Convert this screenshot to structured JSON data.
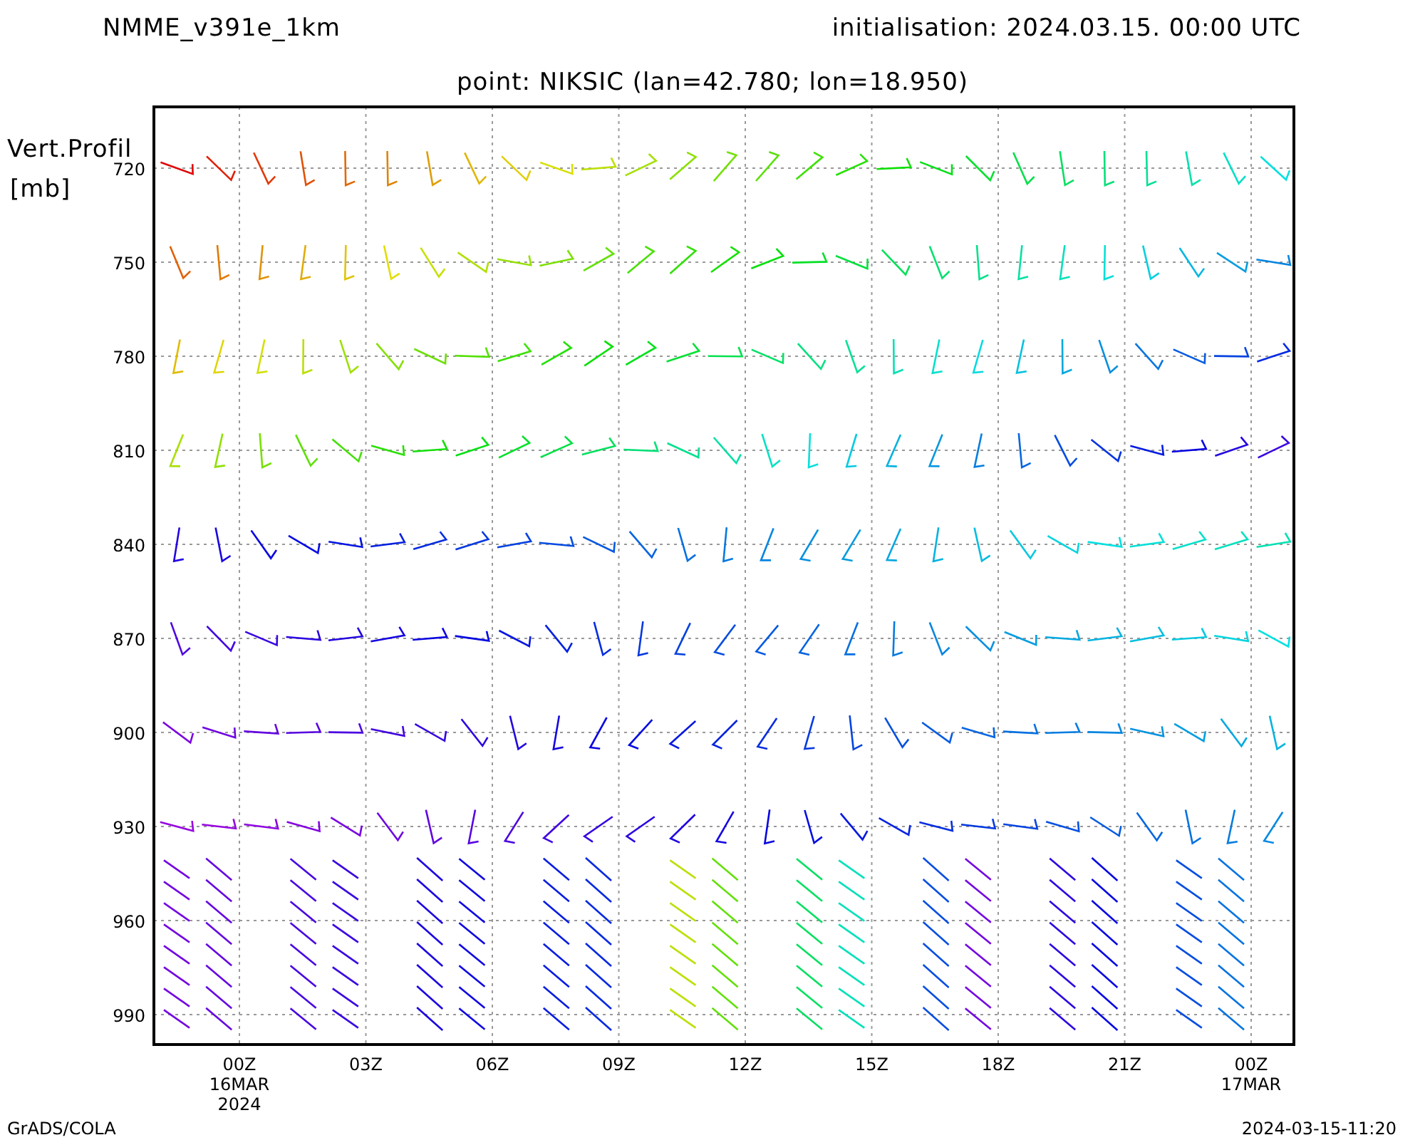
{
  "header": {
    "model": "NMME_v391e_1km",
    "initialisation": "initialisation: 2024.03.15. 00:00 UTC",
    "point": "point: NIKSIC (lan=42.780; lon=18.950)"
  },
  "y_axis": {
    "title": "Vert.Profil",
    "unit": "[mb]",
    "labels": [
      "720",
      "750",
      "780",
      "810",
      "840",
      "870",
      "900",
      "930",
      "960",
      "990"
    ]
  },
  "x_axis": {
    "labels": [
      {
        "text": "00Z",
        "sub": [
          "16MAR",
          "2024"
        ]
      },
      {
        "text": "03Z"
      },
      {
        "text": "06Z"
      },
      {
        "text": "09Z"
      },
      {
        "text": "12Z"
      },
      {
        "text": "15Z"
      },
      {
        "text": "18Z"
      },
      {
        "text": "21Z"
      },
      {
        "text": "00Z",
        "sub": [
          "17MAR"
        ]
      }
    ]
  },
  "footer": {
    "left": "GrADS/COLA",
    "right": "2024-03-15-11:20"
  }
}
